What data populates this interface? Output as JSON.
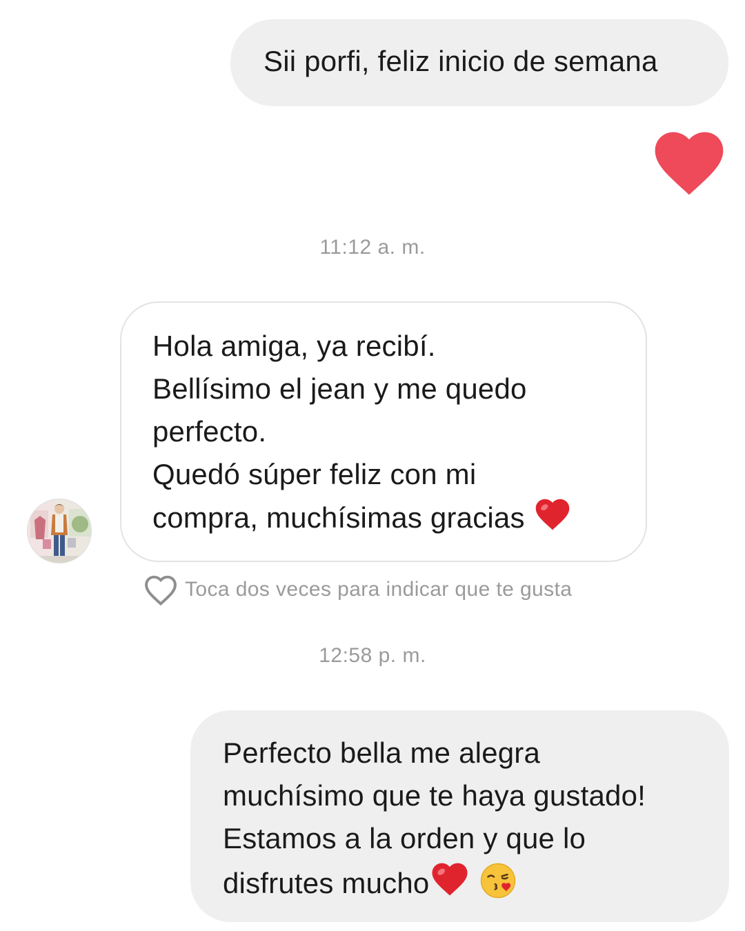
{
  "conversation": {
    "msg1": {
      "sender": "self",
      "lines": [
        "Sii porfi, feliz inicio de semana"
      ]
    },
    "reaction": {
      "icon": "heart-icon",
      "color": "#ee4a5a"
    },
    "time1": "11:12 a. m.",
    "msg2": {
      "sender": "contact",
      "lines": [
        "Hola amiga, ya recibí.",
        "Bellísimo el jean y me quedo",
        "perfecto.",
        "Quedó súper feliz con mi",
        "compra, muchísimas gracias"
      ],
      "trailing_emoji": "red-heart-emoji"
    },
    "like_hint": {
      "icon": "heart-outline-icon",
      "text": "Toca dos veces para indicar que te gusta"
    },
    "time2": "12:58 p. m.",
    "msg3": {
      "sender": "self",
      "lines": [
        "Perfecto bella me alegra",
        "muchísimo que te haya gustado!",
        "Estamos a la orden y que lo",
        "disfrutes mucho"
      ],
      "trailing_emojis": [
        "red-heart-emoji",
        "face-blowing-kiss-emoji"
      ]
    }
  },
  "colors": {
    "sent_bubble": "#efefef",
    "received_border": "#e3e3e3",
    "timestamp_text": "#9a9a9a",
    "reaction_heart": "#ee4a5a",
    "emoji_heart": "#e0242e"
  }
}
